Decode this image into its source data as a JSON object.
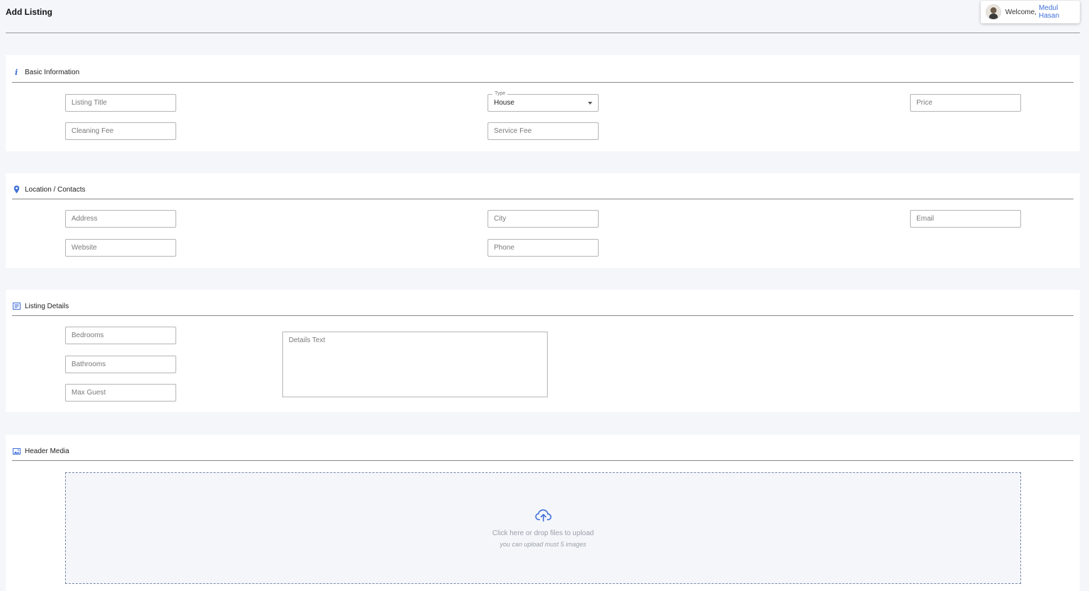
{
  "header": {
    "title": "Add Listing",
    "welcome_prefix": "Welcome,",
    "user_name": "Medul Hasan"
  },
  "colors": {
    "accent": "#3f6fd8",
    "background": "#f5f6fa",
    "card": "#ffffff"
  },
  "sections": {
    "basic": {
      "title": "Basic Information",
      "icon": "info-icon",
      "listing_title_placeholder": "Listing Title",
      "type_label": "Type",
      "type_value": "House",
      "price_placeholder": "Price",
      "cleaning_fee_placeholder": "Cleaning Fee",
      "service_fee_placeholder": "Service Fee"
    },
    "location": {
      "title": "Location / Contacts",
      "icon": "map-pin-icon",
      "address_placeholder": "Address",
      "city_placeholder": "City",
      "email_placeholder": "Email",
      "website_placeholder": "Website",
      "phone_placeholder": "Phone"
    },
    "details": {
      "title": "Listing Details",
      "icon": "list-icon",
      "bedrooms_placeholder": "Bedrooms",
      "bathrooms_placeholder": "Bathrooms",
      "max_guest_placeholder": "Max Guest",
      "details_text_placeholder": "Details Text"
    },
    "media": {
      "title": "Header Media",
      "icon": "image-icon",
      "upload_icon": "cloud-upload-icon",
      "upload_text": "Click here or drop files to upload",
      "upload_hint": "you can upload must 5 images"
    }
  }
}
